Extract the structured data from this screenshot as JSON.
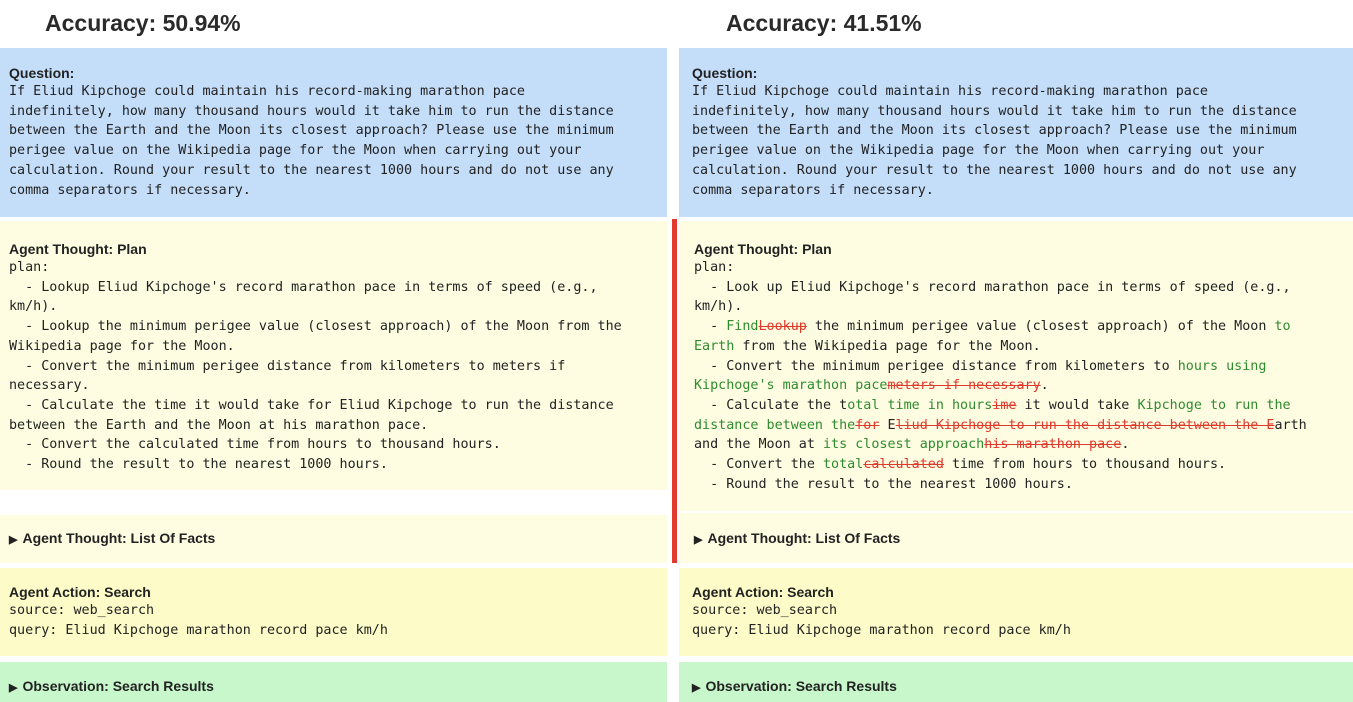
{
  "left": {
    "accuracy": "Accuracy: 50.94%",
    "question": {
      "heading": "Question:",
      "text": "If Eliud Kipchoge could maintain his record-making marathon pace\nindefinitely, how many thousand hours would it take him to run the distance\nbetween the Earth and the Moon its closest approach? Please use the minimum\nperigee value on the Wikipedia page for the Moon when carrying out your\ncalculation. Round your result to the nearest 1000 hours and do not use any\ncomma separators if necessary."
    },
    "plan": {
      "heading": "Agent Thought: Plan",
      "text": "plan:\n  - Lookup Eliud Kipchoge's record marathon pace in terms of speed (e.g.,\nkm/h).\n  - Lookup the minimum perigee value (closest approach) of the Moon from the\nWikipedia page for the Moon.\n  - Convert the minimum perigee distance from kilometers to meters if\nnecessary.\n  - Calculate the time it would take for Eliud Kipchoge to run the distance\nbetween the Earth and the Moon at his marathon pace.\n  - Convert the calculated time from hours to thousand hours.\n  - Round the result to the nearest 1000 hours."
    },
    "facts": {
      "heading": "Agent Thought: List Of Facts"
    },
    "action": {
      "heading": "Agent Action: Search",
      "text": "source: web_search\nquery: Eliud Kipchoge marathon record pace km/h"
    },
    "observation": {
      "heading": "Observation: Search Results"
    }
  },
  "right": {
    "accuracy": "Accuracy: 41.51%",
    "question": {
      "heading": "Question:",
      "text": "If Eliud Kipchoge could maintain his record-making marathon pace\nindefinitely, how many thousand hours would it take him to run the distance\nbetween the Earth and the Moon its closest approach? Please use the minimum\nperigee value on the Wikipedia page for the Moon when carrying out your\ncalculation. Round your result to the nearest 1000 hours and do not use any\ncomma separators if necessary."
    },
    "plan": {
      "heading": "Agent Thought: Plan",
      "segments": [
        {
          "t": "plan:\n  - Look up Eliud Kipchoge's record marathon pace in terms of speed (e.g.,\nkm/h).\n  - ",
          "k": "same"
        },
        {
          "t": "Find",
          "k": "ins"
        },
        {
          "t": "Lookup",
          "k": "del"
        },
        {
          "t": " the minimum perigee value (closest approach) of the Moon ",
          "k": "same"
        },
        {
          "t": "to\nEarth",
          "k": "ins"
        },
        {
          "t": " from the Wikipedia page for the Moon.\n  - Convert the minimum perigee distance from kilometers to ",
          "k": "same"
        },
        {
          "t": "hours using\nKipchoge's marathon pace",
          "k": "ins"
        },
        {
          "t": "meters if necessary",
          "k": "del"
        },
        {
          "t": ".\n  - Calculate the t",
          "k": "same"
        },
        {
          "t": "otal time in hours",
          "k": "ins"
        },
        {
          "t": "ime",
          "k": "del"
        },
        {
          "t": " it would take ",
          "k": "same"
        },
        {
          "t": "Kipchoge to run the\ndistance between the",
          "k": "ins"
        },
        {
          "t": "for",
          "k": "del"
        },
        {
          "t": " E",
          "k": "same"
        },
        {
          "t": "liud Kipchoge to run the distance between the E",
          "k": "del"
        },
        {
          "t": "arth\nand the Moon at ",
          "k": "same"
        },
        {
          "t": "its closest approach",
          "k": "ins"
        },
        {
          "t": "his marathon pace",
          "k": "del"
        },
        {
          "t": ".\n  - Convert the ",
          "k": "same"
        },
        {
          "t": "total",
          "k": "ins"
        },
        {
          "t": "calculated",
          "k": "del"
        },
        {
          "t": " time from hours to thousand hours.\n  - Round the result to the nearest 1000 hours.",
          "k": "same"
        }
      ]
    },
    "facts": {
      "heading": "Agent Thought: List Of Facts"
    },
    "action": {
      "heading": "Agent Action: Search",
      "text": "source: web_search\nquery: Eliud Kipchoge marathon record pace km/h"
    },
    "observation": {
      "heading": "Observation: Search Results"
    }
  },
  "colors": {
    "question_bg": "#c4defa",
    "plan_bg": "#fefde2",
    "action_bg": "#fdfbc7",
    "observation_bg": "#c7f7cb",
    "inserted_text": "#2e8b2e",
    "deleted_text": "#e03a2c",
    "changed_marker": "#e23b2e"
  }
}
